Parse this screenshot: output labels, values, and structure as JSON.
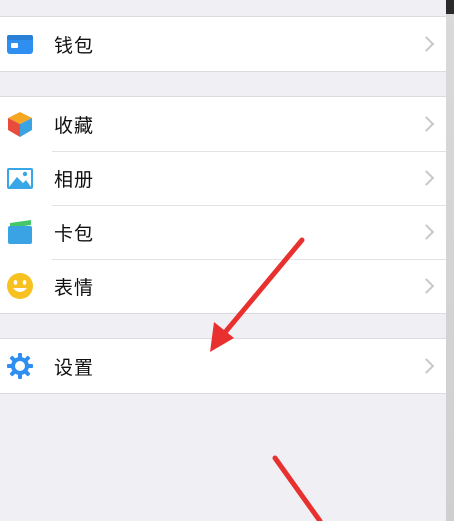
{
  "menu": {
    "wallet": {
      "label": "钱包",
      "icon": "wallet-icon",
      "color": "#2f8ff0"
    },
    "favorites": {
      "label": "收藏",
      "icon": "cube-icon",
      "colors": [
        "#f5a623",
        "#e94b3c",
        "#3aa3e3"
      ]
    },
    "album": {
      "label": "相册",
      "icon": "photo-icon",
      "color": "#37a7e8"
    },
    "cards": {
      "label": "卡包",
      "icon": "card-icon",
      "colors": [
        "#3aa3e3",
        "#44c767"
      ]
    },
    "stickers": {
      "label": "表情",
      "icon": "smiley-icon",
      "color": "#f7c221"
    },
    "settings": {
      "label": "设置",
      "icon": "gear-icon",
      "color": "#2f8ff0"
    }
  },
  "annotation": {
    "arrow_color": "#e8312f"
  }
}
